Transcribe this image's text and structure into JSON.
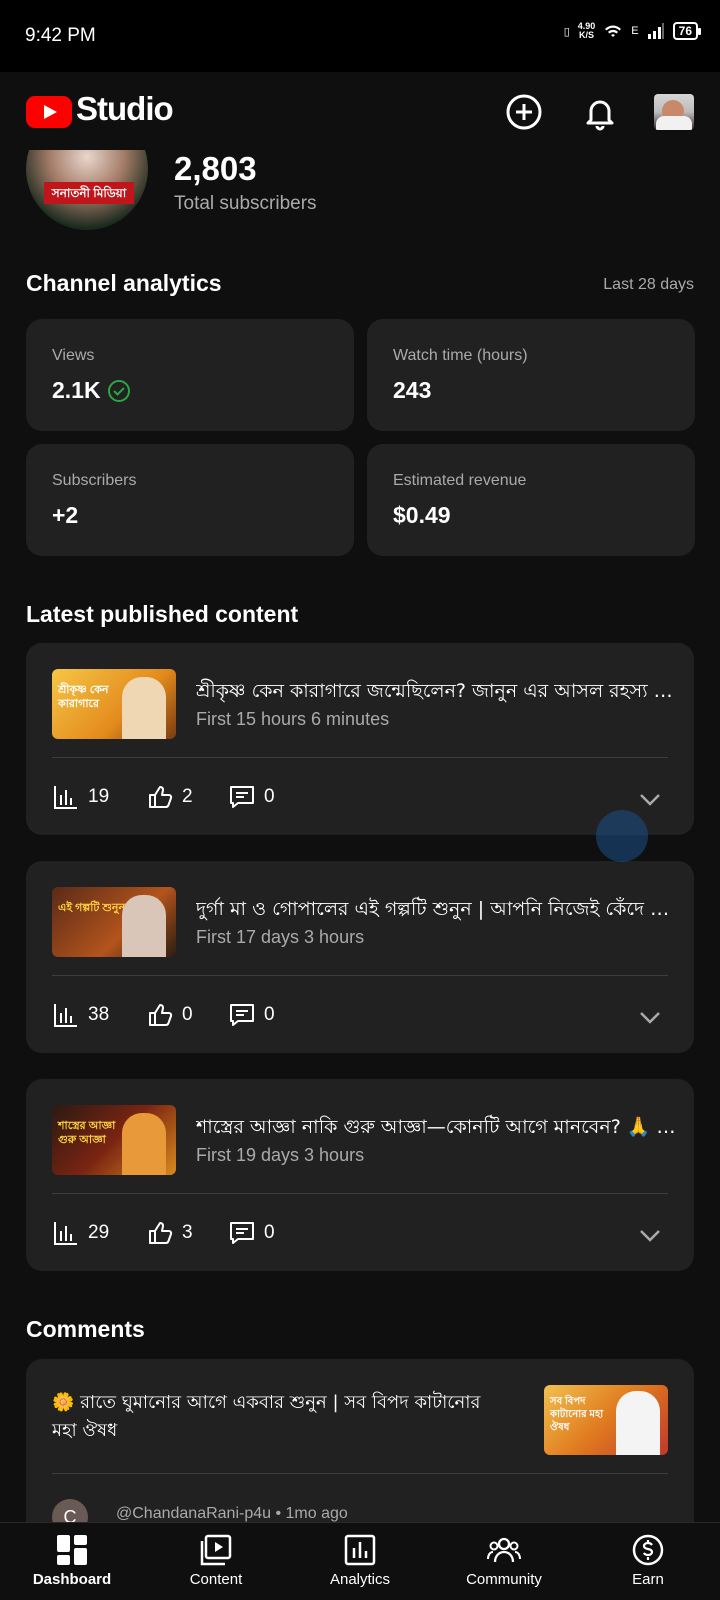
{
  "status_bar": {
    "time": "9:42 PM",
    "net_speed": "4.90",
    "net_unit": "K/S",
    "network": "E",
    "battery": "76"
  },
  "header": {
    "app_name": "Studio"
  },
  "channel": {
    "subscribers": "2,803",
    "subscribers_label": "Total subscribers",
    "pic_banner": "সনাতনী মিডিয়া"
  },
  "analytics": {
    "title": "Channel analytics",
    "period": "Last 28 days",
    "cards": [
      {
        "label": "Views",
        "value": "2.1K"
      },
      {
        "label": "Watch time (hours)",
        "value": "243"
      },
      {
        "label": "Subscribers",
        "value": "+2"
      },
      {
        "label": "Estimated revenue",
        "value": "$0.49"
      }
    ]
  },
  "latest": {
    "title": "Latest published content",
    "items": [
      {
        "title": "শ্রীকৃষ্ণ কেন কারাগারে জন্মেছিলেন? জানুন এর আসল রহস্য | শ্রীকৃষ্ণ",
        "subtitle": "First 15 hours 6 minutes",
        "views": "19",
        "likes": "2",
        "comments": "0",
        "thumb_text": "শ্রীকৃষ্ণ কেন কারাগারে"
      },
      {
        "title": "দুর্গা মা ও গোপালের এই গল্পটি শুনুন | আপনি নিজেই কেঁদে ফেলবেন",
        "subtitle": "First 17 days 3 hours",
        "views": "38",
        "likes": "0",
        "comments": "0",
        "thumb_text": "এই গল্পটি শুনুন"
      },
      {
        "title": "শাস্ত্রের আজ্ঞা নাকি গুরু আজ্ঞা—কোনটি আগে মানবেন? 🙏 সনাতন",
        "subtitle": "First 19 days 3 hours",
        "views": "29",
        "likes": "3",
        "comments": "0",
        "thumb_text": "শাস্ত্রের আজ্ঞা গুরু আজ্ঞা"
      }
    ]
  },
  "comments": {
    "title": "Comments",
    "video_title": "🌼 রাতে ঘুমানোর আগে একবার শুনুন | সব বিপদ কাটানোর মহা ঔষধ",
    "thumb_text": "সব বিপদ কাটানোর মহা ঔষধ",
    "author": "@ChandanaRani-p4u",
    "time": "1mo ago",
    "author_initial": "C"
  },
  "nav": {
    "items": [
      {
        "label": "Dashboard",
        "icon": "dashboard-icon"
      },
      {
        "label": "Content",
        "icon": "content-icon"
      },
      {
        "label": "Analytics",
        "icon": "analytics-icon"
      },
      {
        "label": "Community",
        "icon": "community-icon"
      },
      {
        "label": "Earn",
        "icon": "earn-icon"
      }
    ]
  },
  "colors": {
    "brand": "#ff0000",
    "card": "#212121",
    "background": "#0f0f0f",
    "check": "#2ba640"
  }
}
